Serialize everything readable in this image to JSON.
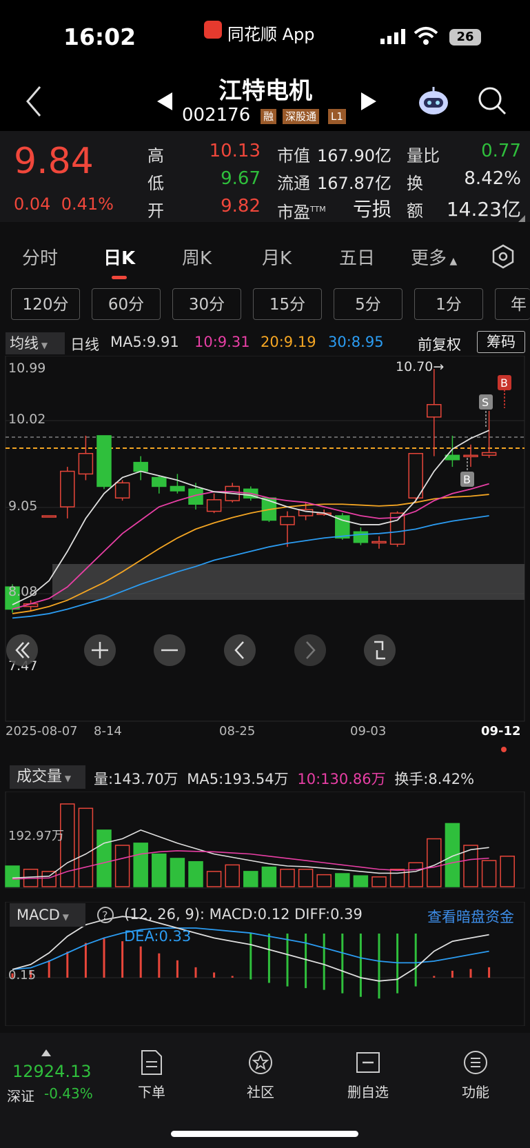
{
  "status_bar": {
    "time": "16:02",
    "app": "同花顺 App",
    "battery": "26"
  },
  "header": {
    "name": "江特电机",
    "code": "002176",
    "tags": [
      "融",
      "深股通",
      "L1"
    ]
  },
  "quote": {
    "price": "9.84",
    "change": "0.04",
    "change_pct": "0.41%",
    "high_label": "高",
    "high": "10.13",
    "low_label": "低",
    "low": "9.67",
    "open_label": "开",
    "open": "9.82",
    "mcap_label": "市值",
    "mcap": "167.90亿",
    "float_label": "流通",
    "float": "167.87亿",
    "pe_label": "市盈",
    "pe_sup": "TTM",
    "pe": "亏损",
    "vr_label": "量比",
    "vr": "0.77",
    "turn_label": "换",
    "turn": "8.42%",
    "amt_label": "额",
    "amt": "14.23亿"
  },
  "tabs": [
    "分时",
    "日K",
    "周K",
    "月K",
    "五日",
    "更多"
  ],
  "periods": [
    "120分",
    "60分",
    "30分",
    "15分",
    "5分",
    "1分",
    "年"
  ],
  "legend": {
    "select": "均线",
    "day": "日线",
    "ma5": "MA5:9.91",
    "ma10": "10:9.31",
    "ma20": "20:9.19",
    "ma30": "30:8.95",
    "adj": "前复权",
    "chip": "筹码"
  },
  "chart_data": {
    "type": "candlestick",
    "price_axis_labels": [
      "10.99",
      "10.02",
      "9.05",
      "8.08",
      "7.47"
    ],
    "date_labels": [
      "2025-08-07",
      "8-14",
      "08-25",
      "09-03",
      "09-12"
    ],
    "annotations": [
      "10.70→",
      "S",
      "B",
      "B"
    ],
    "candles": [
      [
        8.15,
        7.9,
        8.18,
        7.86
      ],
      [
        7.93,
        7.96,
        8.0,
        7.88
      ],
      [
        8.95,
        8.95,
        8.95,
        8.95
      ],
      [
        9.05,
        9.45,
        9.5,
        8.92
      ],
      [
        9.42,
        9.65,
        9.85,
        9.35
      ],
      [
        9.85,
        9.28,
        9.85,
        9.25
      ],
      [
        9.15,
        9.32,
        9.35,
        9.12
      ],
      [
        9.55,
        9.45,
        9.62,
        9.35
      ],
      [
        9.38,
        9.28,
        9.4,
        9.2
      ],
      [
        9.28,
        9.23,
        9.42,
        9.2
      ],
      [
        9.25,
        9.08,
        9.32,
        9.02
      ],
      [
        9.0,
        9.13,
        9.2,
        8.98
      ],
      [
        9.12,
        9.28,
        9.32,
        9.1
      ],
      [
        9.25,
        9.15,
        9.28,
        9.12
      ],
      [
        9.15,
        8.9,
        9.15,
        8.88
      ],
      [
        8.85,
        8.94,
        9.0,
        8.6
      ],
      [
        8.95,
        9.02,
        9.1,
        8.9
      ],
      [
        8.98,
        8.98,
        9.02,
        8.95
      ],
      [
        8.95,
        8.7,
        8.98,
        8.68
      ],
      [
        8.77,
        8.65,
        8.82,
        8.62
      ],
      [
        8.65,
        8.66,
        8.72,
        8.58
      ],
      [
        8.63,
        8.98,
        9.0,
        8.6
      ],
      [
        9.15,
        9.65,
        9.65,
        9.1
      ],
      [
        10.06,
        10.2,
        10.6,
        9.62
      ],
      [
        9.63,
        9.58,
        9.85,
        9.5
      ],
      [
        9.62,
        9.63,
        9.75,
        9.5
      ],
      [
        9.63,
        9.66,
        10.13,
        9.6
      ]
    ],
    "ma5": [
      7.95,
      8.05,
      8.22,
      8.55,
      8.92,
      9.2,
      9.38,
      9.45,
      9.4,
      9.35,
      9.28,
      9.22,
      9.2,
      9.18,
      9.12,
      9.05,
      9.0,
      8.98,
      8.9,
      8.85,
      8.85,
      8.9,
      9.12,
      9.45,
      9.7,
      9.82,
      9.91
    ],
    "ma10": [
      7.9,
      7.96,
      8.02,
      8.15,
      8.35,
      8.55,
      8.75,
      8.9,
      9.05,
      9.12,
      9.18,
      9.22,
      9.22,
      9.2,
      9.15,
      9.12,
      9.1,
      9.05,
      9.0,
      8.95,
      8.92,
      8.93,
      9.0,
      9.12,
      9.2,
      9.25,
      9.31
    ],
    "ma20": [
      7.85,
      7.88,
      7.93,
      8.0,
      8.1,
      8.2,
      8.32,
      8.45,
      8.58,
      8.7,
      8.8,
      8.87,
      8.93,
      8.98,
      9.02,
      9.05,
      9.07,
      9.08,
      9.08,
      9.07,
      9.06,
      9.07,
      9.1,
      9.14,
      9.16,
      9.17,
      9.19
    ],
    "ma30": [
      7.8,
      7.82,
      7.85,
      7.9,
      7.96,
      8.02,
      8.1,
      8.18,
      8.25,
      8.32,
      8.38,
      8.45,
      8.5,
      8.55,
      8.6,
      8.64,
      8.67,
      8.7,
      8.72,
      8.74,
      8.75,
      8.77,
      8.8,
      8.85,
      8.89,
      8.92,
      8.95
    ]
  },
  "volume": {
    "select": "成交量",
    "vol": "量:143.70万",
    "ma5": "MA5:193.54万",
    "ma10": "10:130.86万",
    "turnover": "换手:8.42%",
    "axis_label": "192.97万",
    "bars": [
      95,
      80,
      70,
      380,
      360,
      260,
      190,
      200,
      150,
      130,
      115,
      70,
      100,
      70,
      90,
      80,
      80,
      55,
      60,
      50,
      45,
      80,
      110,
      220,
      290,
      190,
      120,
      140
    ]
  },
  "macd": {
    "select": "MACD",
    "params": "(12, 26, 9): MACD:0.12  DIFF:0.39",
    "dea": "DEA:0.33",
    "dark_pool": "查看暗盘资金",
    "axis_label": "0.15",
    "hist": [
      0.05,
      0.08,
      0.2,
      0.3,
      0.4,
      0.45,
      0.42,
      0.36,
      0.28,
      0.2,
      0.12,
      0.06,
      0.02,
      -0.02,
      -0.06,
      -0.1,
      -0.12,
      -0.14,
      -0.18,
      -0.22,
      -0.24,
      -0.18,
      -0.1,
      0.02,
      0.08,
      0.1,
      0.12
    ]
  },
  "bottom": {
    "index_value": "12924.13",
    "index_name": "深证",
    "index_change": "-0.43%",
    "nav": [
      "下单",
      "社区",
      "删自选",
      "功能"
    ]
  }
}
